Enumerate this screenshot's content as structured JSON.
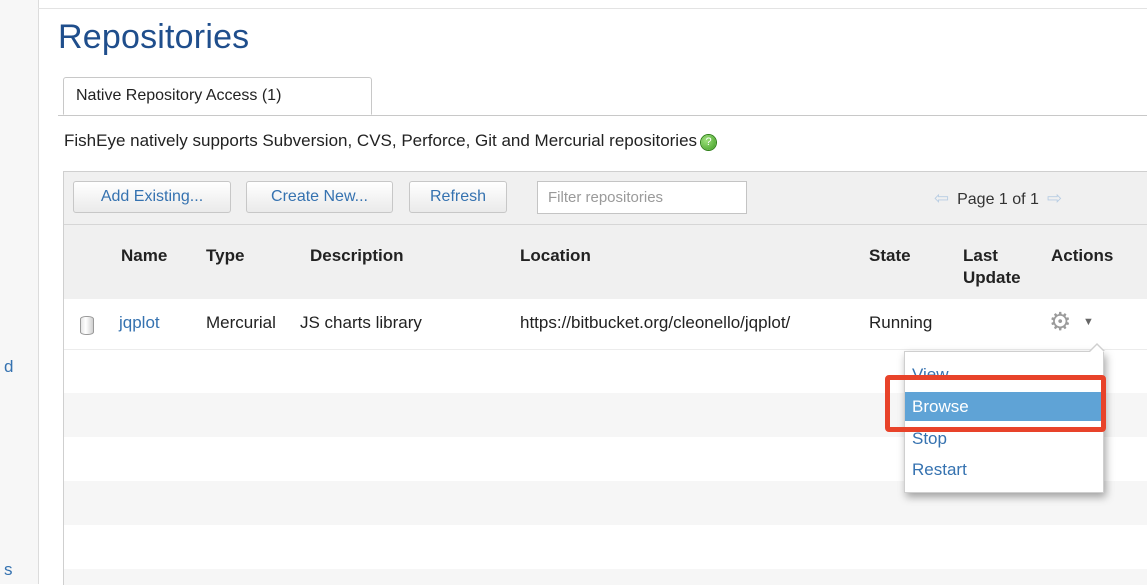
{
  "page": {
    "title": "Repositories"
  },
  "tabs": [
    {
      "label": "Native Repository Access (1)"
    }
  ],
  "intro": {
    "text": "FishEye natively supports Subversion, CVS, Perforce, Git and Mercurial repositories"
  },
  "toolbar": {
    "add_existing": "Add Existing...",
    "create_new": "Create New...",
    "refresh": "Refresh",
    "filter_placeholder": "Filter repositories",
    "page_text": "Page 1 of 1",
    "prev_icon": "⇦",
    "next_icon": "⇨"
  },
  "table": {
    "columns": {
      "name": "Name",
      "type": "Type",
      "description": "Description",
      "location": "Location",
      "state": "State",
      "last_update_1": "Last",
      "last_update_2": "Update",
      "actions": "Actions"
    },
    "rows": [
      {
        "name": "jqplot",
        "type": "Mercurial",
        "description": "JS charts library",
        "location": "https://bitbucket.org/cleonello/jqplot/",
        "state": "Running",
        "last_update": ""
      }
    ]
  },
  "actions_menu": {
    "items": [
      "View",
      "Browse",
      "Stop",
      "Restart"
    ],
    "selected": "Browse"
  },
  "left_rail": {
    "frag1": "d",
    "frag2": "s"
  },
  "colors": {
    "link": "#3572b0",
    "title": "#1f4e8c",
    "menu_active": "#5fa3d6",
    "highlight": "#e8432a"
  }
}
